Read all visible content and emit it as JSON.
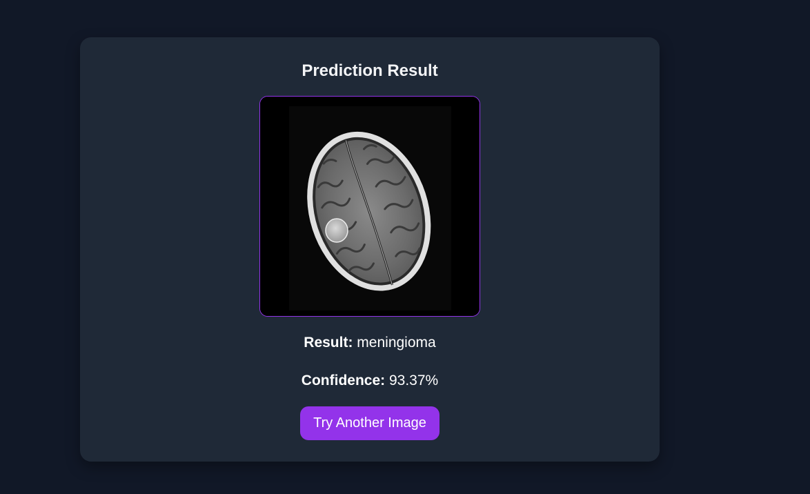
{
  "card": {
    "title": "Prediction Result",
    "image_alt": "brain MRI scan"
  },
  "prediction": {
    "result_label": "Result:",
    "result_value": "meningioma",
    "confidence_label": "Confidence:",
    "confidence_value": "93.37%"
  },
  "actions": {
    "retry_label": "Try Another Image"
  },
  "colors": {
    "page_background": "#111827",
    "card_background": "#1f2937",
    "accent": "#9333ea",
    "text": "#ffffff"
  }
}
